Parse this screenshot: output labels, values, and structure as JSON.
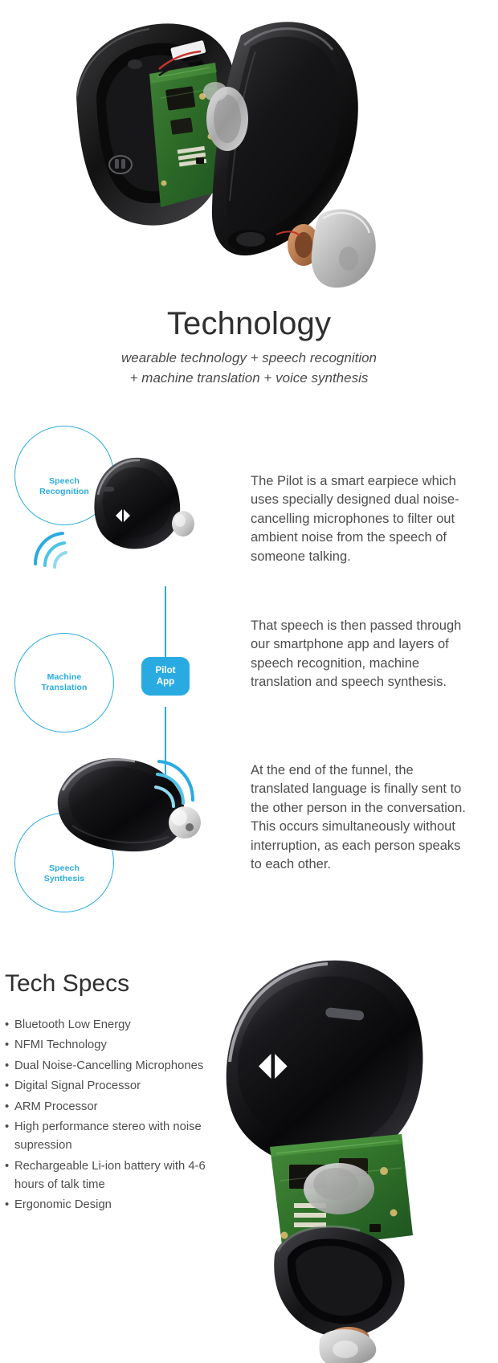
{
  "header": {
    "title": "Technology",
    "subtitle_line1": "wearable technology + speech recognition",
    "subtitle_line2": "+ machine translation + voice synthesis"
  },
  "colors": {
    "accent": "#29ABE2",
    "accent_light": "#9BDCF2",
    "text": "#4d4d4d",
    "heading": "#2f2f2f",
    "background": "#ffffff"
  },
  "flow": {
    "steps": [
      {
        "label_line1": "Speech",
        "label_line2": "Recognition"
      },
      {
        "label_line1": "Machine",
        "label_line2": "Translation"
      },
      {
        "label_line1": "Speech",
        "label_line2": "Synthesis"
      }
    ],
    "badge": {
      "line1": "Pilot",
      "line2": "App"
    },
    "paragraphs": [
      "The Pilot is a smart earpiece which uses specially designed dual noise-cancelling microphones to filter out ambient noise from the speech of someone talking.",
      "That speech is then passed through our smartphone app and layers of speech recognition, machine translation and speech synthesis.",
      "At the end of the funnel, the translated language is finally sent to the other person in the conversation. This occurs simultaneously without interruption, as each person speaks to each other."
    ]
  },
  "specs": {
    "title": "Tech Specs",
    "items": [
      "Bluetooth Low Energy",
      "NFMI Technology",
      "Dual Noise-Cancelling Microphones",
      "Digital Signal Processor",
      "ARM Processor",
      "High performance stereo with noise supression",
      "Rechargeable Li-ion battery with 4-6 hours of talk time",
      "Ergonomic Design"
    ]
  },
  "icons": {
    "hero": "exploded-earpiece-illustration",
    "earpiece_recognition": "earpiece-side-view-illustration",
    "earpiece_synthesis": "earpiece-angled-view-illustration",
    "specs_art": "exploded-earpiece-illustration",
    "sound_waves": "sound-wave-icon"
  }
}
